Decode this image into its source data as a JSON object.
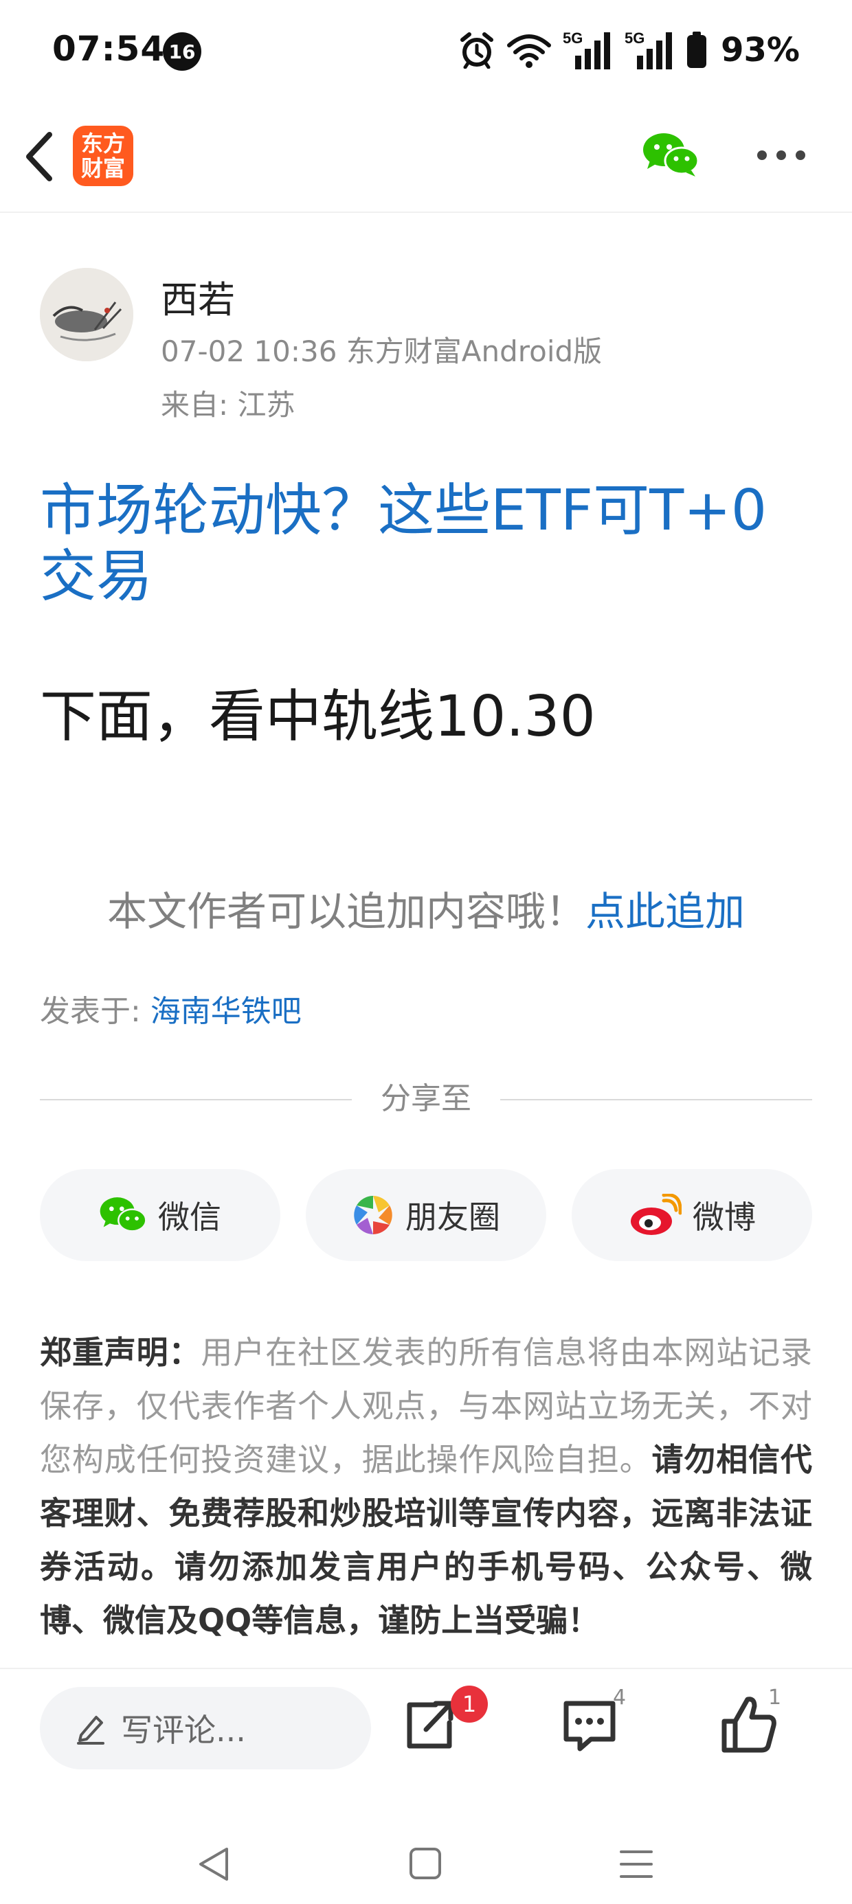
{
  "status_bar": {
    "time": "07:54",
    "notification_count": "16",
    "network_1": "5G",
    "network_2": "5G",
    "battery": "93%"
  },
  "header": {
    "logo_line1": "东方",
    "logo_line2": "财富",
    "icons": [
      "back-icon",
      "wechat-icon",
      "more-icon"
    ]
  },
  "author": {
    "name": "西若",
    "meta": "07-02 10:36 东方财富Android版",
    "location": "来自: 江苏"
  },
  "post": {
    "title": "市场轮动快？这些ETF可T+0交易",
    "body": "下面，看中轨线10.30"
  },
  "append": {
    "notice": "本文作者可以追加内容哦！",
    "link": "点此追加"
  },
  "published": {
    "label": "发表于: ",
    "bar": "海南华铁吧"
  },
  "share": {
    "label": "分享至",
    "buttons": [
      {
        "label": "微信",
        "icon": "wechat-icon"
      },
      {
        "label": "朋友圈",
        "icon": "moments-icon"
      },
      {
        "label": "微博",
        "icon": "weibo-icon"
      }
    ]
  },
  "disclaimer": {
    "heading": "郑重声明：",
    "text_plain": "用户在社区发表的所有信息将由本网站记录保存，仅代表作者个人观点，与本网站立场无关，不对您构成任何投资建议，据此操作风险自担。",
    "text_bold": "请勿相信代客理财、免费荐股和炒股培训等宣传内容，远离非法证券活动。请勿添加发言用户的手机号码、公众号、微博、微信及QQ等信息，谨防上当受骗！"
  },
  "actions": {
    "comment_placeholder": "写评论...",
    "share_badge": "1",
    "comment_count": "4",
    "like_count": "1"
  },
  "colors": {
    "link_blue": "#1a6fc4",
    "brand_orange": "#ff5a1f",
    "badge_red": "#e8313b"
  }
}
